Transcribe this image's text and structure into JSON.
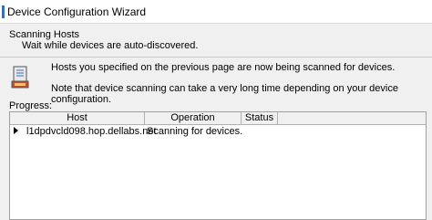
{
  "window": {
    "title": "Device Configuration Wizard"
  },
  "header": {
    "title": "Scanning Hosts",
    "subtitle": "Wait while devices are auto-discovered."
  },
  "info": {
    "line1": "Hosts you specified on the previous page are now being scanned for devices.",
    "line2": "Note that device scanning can take a very long time depending on your device configuration."
  },
  "progress": {
    "label": "Progress:",
    "columns": [
      "Host",
      "Operation",
      "Status"
    ],
    "rows": [
      {
        "host": "l1dpdvcld098.hop.dellabs.net",
        "operation": "Scanning for devices.",
        "status": ""
      }
    ]
  }
}
